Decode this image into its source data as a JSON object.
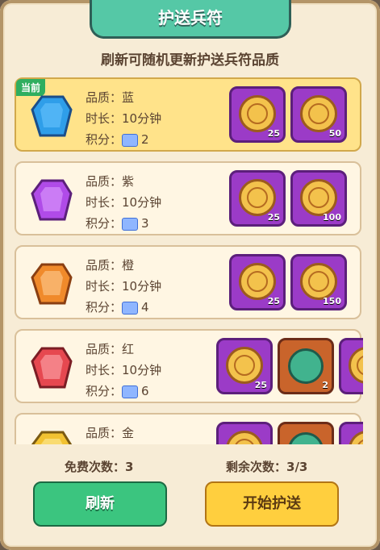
{
  "title": "护送兵符",
  "subtitle": "刷新可随机更新护送兵符品质",
  "current_badge": "当前",
  "labels": {
    "quality": "品质：",
    "duration": "时长：",
    "score": "积分："
  },
  "items": [
    {
      "quality": "蓝",
      "duration": "10分钟",
      "score": "2",
      "gem_color": "#2f9ee9",
      "rewards": [
        {
          "type": "coin",
          "frame": "purple",
          "count": "25"
        },
        {
          "type": "coin",
          "frame": "purple",
          "count": "50"
        }
      ],
      "active": true
    },
    {
      "quality": "紫",
      "duration": "10分钟",
      "score": "3",
      "gem_color": "#b04be8",
      "rewards": [
        {
          "type": "coin",
          "frame": "purple",
          "count": "25"
        },
        {
          "type": "coin",
          "frame": "purple",
          "count": "100"
        }
      ],
      "active": false
    },
    {
      "quality": "橙",
      "duration": "10分钟",
      "score": "4",
      "gem_color": "#f08a2b",
      "rewards": [
        {
          "type": "coin",
          "frame": "purple",
          "count": "25"
        },
        {
          "type": "coin",
          "frame": "purple",
          "count": "150"
        }
      ],
      "active": false
    },
    {
      "quality": "红",
      "duration": "10分钟",
      "score": "6",
      "gem_color": "#e64850",
      "rewards": [
        {
          "type": "coin",
          "frame": "purple",
          "count": "25"
        },
        {
          "type": "jade",
          "frame": "orange",
          "count": "2"
        },
        {
          "type": "coin",
          "frame": "purple",
          "count": ""
        }
      ],
      "active": false
    },
    {
      "quality": "金",
      "duration": "",
      "score": "",
      "gem_color": "#f2c232",
      "rewards": [
        {
          "type": "coin",
          "frame": "purple",
          "count": ""
        },
        {
          "type": "jade",
          "frame": "orange",
          "count": ""
        },
        {
          "type": "coin",
          "frame": "purple",
          "count": ""
        }
      ],
      "active": false
    }
  ],
  "free_count_label": "免费次数：",
  "free_count_value": "3",
  "remaining_label": "剩余次数：",
  "remaining_value": "3/3",
  "buttons": {
    "refresh": "刷新",
    "start": "开始护送"
  }
}
